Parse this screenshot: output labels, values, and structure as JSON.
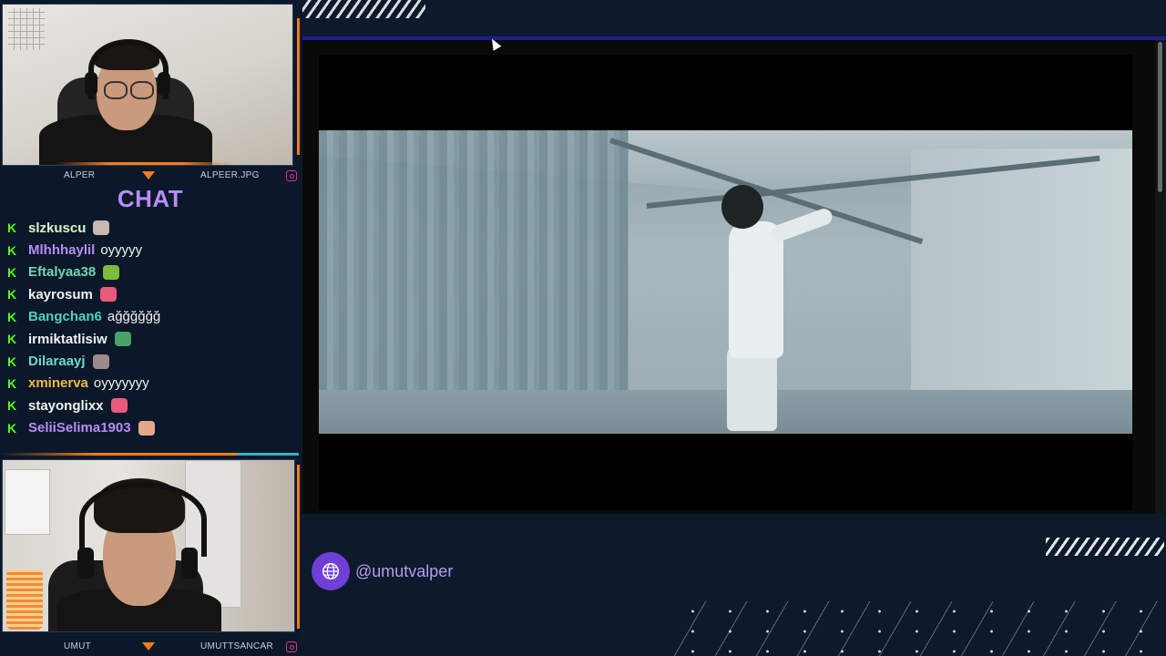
{
  "streamers": {
    "top": {
      "name": "ALPER",
      "handle": "ALPEER.JPG"
    },
    "bottom": {
      "name": "UMUT",
      "handle": "UMUTTSANCAR"
    }
  },
  "chat": {
    "title": "CHAT",
    "messages": [
      {
        "user": "slzkuscu",
        "text": "",
        "color": "#d9f7c8",
        "emote": "cat-emote"
      },
      {
        "user": "Mlhhhaylil",
        "text": "oyyyyy",
        "color": "#b78cf4",
        "emote": ""
      },
      {
        "user": "Eftalyaa38",
        "text": "",
        "color": "#6fd6b0",
        "emote": "frog-emote"
      },
      {
        "user": "kayrosum",
        "text": "",
        "color": "#f2f2f2",
        "emote": "heart-hands-emote"
      },
      {
        "user": "Bangchan6",
        "text": "ağğğğğğ",
        "color": "#4fd3b8",
        "emote": ""
      },
      {
        "user": "irmiktatlisiw",
        "text": "",
        "color": "#f2f2f2",
        "emote": "car-emote"
      },
      {
        "user": "Dilaraayj",
        "text": "",
        "color": "#6fd6d0",
        "emote": "cat-paws-emote"
      },
      {
        "user": "xminerva",
        "text": "oyyyyyyy",
        "color": "#f2b84a",
        "emote": ""
      },
      {
        "user": "stayonglixx",
        "text": "",
        "color": "#f2f2f2",
        "emote": "heart-hands-emote"
      },
      {
        "user": "SeliiSelima1903",
        "text": "",
        "color": "#b78cf4",
        "emote": "face-emote"
      }
    ]
  },
  "social": {
    "handle": "@umutvalper",
    "icon": "globe-icon"
  },
  "colors": {
    "accent": "#f47b20",
    "purple": "#6f3fd6",
    "kick": "#53fc18",
    "top_line": "#1c1d8c"
  }
}
